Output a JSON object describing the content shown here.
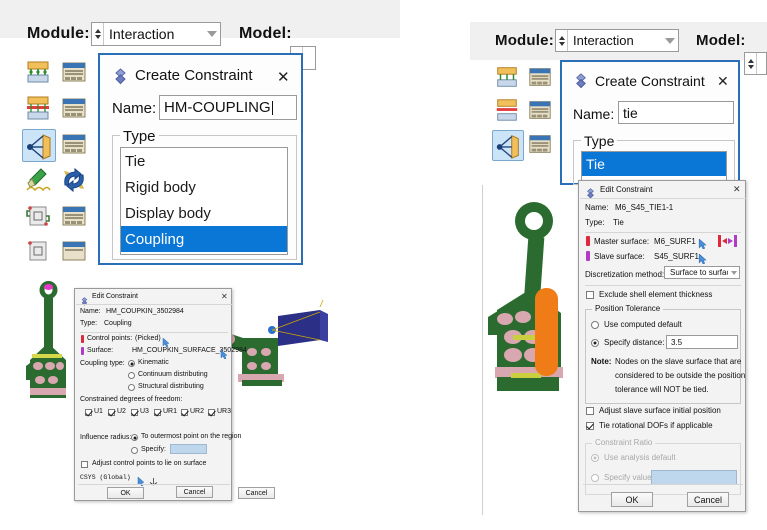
{
  "app": {
    "module_label": "Module:",
    "module_value": "Interaction",
    "model_label": "Model:"
  },
  "toolbar": {
    "icons": [
      {
        "name": "create-interaction-icon",
        "tip": "Create Interaction"
      },
      {
        "name": "interaction-manager-icon",
        "tip": "Interaction Manager"
      },
      {
        "name": "create-interaction-property-icon",
        "tip": "Create Interaction Property"
      },
      {
        "name": "interaction-property-manager-icon",
        "tip": "Interaction Property Manager"
      },
      {
        "name": "create-constraint-icon",
        "tip": "Create Constraint",
        "selected": true
      },
      {
        "name": "constraint-manager-icon",
        "tip": "Constraint Manager"
      },
      {
        "name": "create-contact-initialization-icon",
        "tip": "Create Contact Initialization"
      },
      {
        "name": "find-contact-pairs-icon",
        "tip": "Find Contact Pairs"
      },
      {
        "name": "create-connector-section-icon",
        "tip": "Create Connector Section"
      },
      {
        "name": "connector-section-manager-icon",
        "tip": "Connector Section Manager"
      },
      {
        "name": "create-connector-assignment-icon",
        "tip": "Create Connector Assignment"
      },
      {
        "name": "connector-assignment-manager-icon",
        "tip": "Connector Assignment Manager"
      }
    ]
  },
  "left": {
    "create_constraint": {
      "title": "Create Constraint",
      "close": "✕",
      "name_label": "Name:",
      "name_value": "HM-COUPLING",
      "type_caption": "Type",
      "type_options": [
        "Tie",
        "Rigid body",
        "Display body",
        "Coupling"
      ],
      "type_selected": "Coupling"
    },
    "edit_constraint": {
      "title": "Edit Constraint",
      "close": "✕",
      "name_label": "Name:",
      "name_value": "HM_COUPKIN_3502984",
      "type_label": "Type:",
      "type_value": "Coupling",
      "control_points_label": "Control points:",
      "control_points_value": "(Picked)",
      "surface_label": "Surface:",
      "surface_value": "HM_COUPKIN_SURFACE_3502984",
      "coupling_type_label": "Coupling type:",
      "coupling_options": [
        "Kinematic",
        "Continuum distributing",
        "Structural distributing"
      ],
      "coupling_selected": "Kinematic",
      "dof_label": "Constrained degrees of freedom:",
      "dofs": [
        {
          "label": "U1",
          "checked": true
        },
        {
          "label": "U2",
          "checked": true
        },
        {
          "label": "U3",
          "checked": true
        },
        {
          "label": "UR1",
          "checked": true
        },
        {
          "label": "UR2",
          "checked": true
        },
        {
          "label": "UR3",
          "checked": true
        }
      ],
      "influence_label": "Influence radius:",
      "influence_options": [
        "To outermost point on the region",
        "Specify:"
      ],
      "influence_selected": "To outermost point on the region",
      "influence_specify_value": "",
      "adjust_label": "Adjust control points to lie on surface",
      "adjust_checked": false,
      "csys_label": "CSYS  (Global)",
      "ok": "OK",
      "cancel": "Cancel"
    }
  },
  "right": {
    "create_constraint": {
      "title": "Create Constraint",
      "close": "✕",
      "name_label": "Name:",
      "name_value": "tie",
      "type_caption": "Type",
      "type_options": [
        "Tie"
      ],
      "type_selected": "Tie"
    },
    "edit_constraint": {
      "title": "Edit Constraint",
      "close": "✕",
      "name_label": "Name:",
      "name_value": "M6_S45_TIE1-1",
      "type_label": "Type:",
      "type_value": "Tie",
      "master_label": "Master surface:",
      "master_value": "M6_SURF1",
      "slave_label": "Slave surface:",
      "slave_value": "S45_SURF1",
      "discretization_label": "Discretization method:",
      "discretization_value": "Surface to surface",
      "exclude_shell_label": "Exclude shell element thickness",
      "exclude_shell_checked": false,
      "position_tolerance_caption": "Position Tolerance",
      "tolerance_options": [
        "Use computed default",
        "Specify distance:"
      ],
      "tolerance_selected": "Specify distance:",
      "specify_distance_value": "3.5",
      "note_label": "Note:",
      "note_lines": [
        "Nodes on the slave surface that are",
        "considered to be outside the position",
        "tolerance will NOT be tied."
      ],
      "adjust_slave_label": "Adjust slave surface initial position",
      "adjust_slave_checked": false,
      "tie_rot_label": "Tie rotational DOFs if applicable",
      "tie_rot_checked": true,
      "constraint_ratio_caption": "Constraint Ratio",
      "ratio_options": [
        "Use analysis default",
        "Specify value"
      ],
      "ratio_selected": "Use analysis default",
      "ratio_value": "",
      "ok": "OK",
      "cancel": "Cancel"
    }
  },
  "colors": {
    "select_blue": "#0a76d6",
    "dialog_border_blue": "#2a6fb5",
    "field_bg_blue": "#bfd7ec",
    "mesh_green": "#2c6b2f",
    "mesh_pink": "#d9a7b0",
    "highlight_orange": "#f07c18",
    "master_red": "#e0283c",
    "slave_magenta": "#b03bc4",
    "toolbar_gray": "#f0f0f0"
  }
}
